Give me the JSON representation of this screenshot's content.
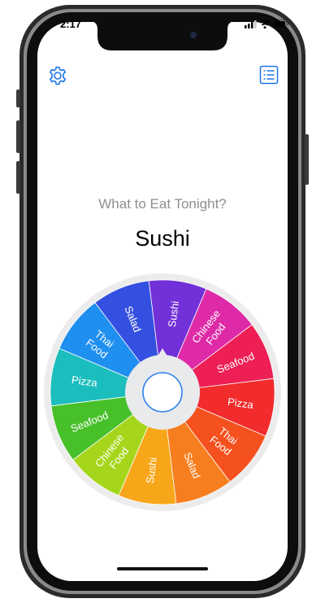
{
  "status_bar": {
    "time": "2:17"
  },
  "toolbar": {
    "settings_icon": "gear-icon",
    "list_icon": "list-icon",
    "accent_color": "#1a73e8"
  },
  "prompt": {
    "question": "What to Eat Tonight?",
    "result": "Sushi"
  },
  "wheel": {
    "segments": [
      {
        "label": "Sushi",
        "color": "#7230d8"
      },
      {
        "label": "Chinese Food",
        "color": "#de2aa6"
      },
      {
        "label": "Seafood",
        "color": "#ee1f55"
      },
      {
        "label": "Pizza",
        "color": "#f22b2d"
      },
      {
        "label": "Thai Food",
        "color": "#f5511e"
      },
      {
        "label": "Salad",
        "color": "#f77e1f"
      },
      {
        "label": "Sushi",
        "color": "#f8a619"
      },
      {
        "label": "Chinese Food",
        "color": "#a6d61b"
      },
      {
        "label": "Seafood",
        "color": "#47c02a"
      },
      {
        "label": "Pizza",
        "color": "#1bbebd"
      },
      {
        "label": "Thai Food",
        "color": "#1f8ff0"
      },
      {
        "label": "Salad",
        "color": "#3450e0"
      }
    ],
    "spin_button_color": "#2d80f0"
  }
}
